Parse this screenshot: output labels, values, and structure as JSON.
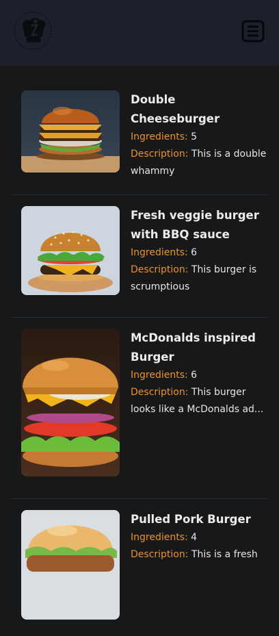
{
  "header": {
    "logo_icon": "chef-hat-logo-icon",
    "menu_icon": "hamburger-menu-icon"
  },
  "colors": {
    "header_bg": "#1b202a",
    "page_bg": "#16181a",
    "label_accent": "#f0922c",
    "text": "#e8e8e8"
  },
  "labels": {
    "ingredients": "Ingredients:",
    "description": "Description:"
  },
  "recipes": [
    {
      "name": "Double Cheeseburger",
      "ingredients": "5",
      "description": "This is a double whammy"
    },
    {
      "name": "Fresh veggie burger with BBQ sauce",
      "ingredients": "6",
      "description": "This burger is scrumptious"
    },
    {
      "name": "McDonalds inspired Burger",
      "ingredients": "6",
      "description": "This burger looks like a McDonalds ad..."
    },
    {
      "name": "Pulled Pork Burger",
      "ingredients": "4",
      "description": "This is a fresh"
    }
  ]
}
